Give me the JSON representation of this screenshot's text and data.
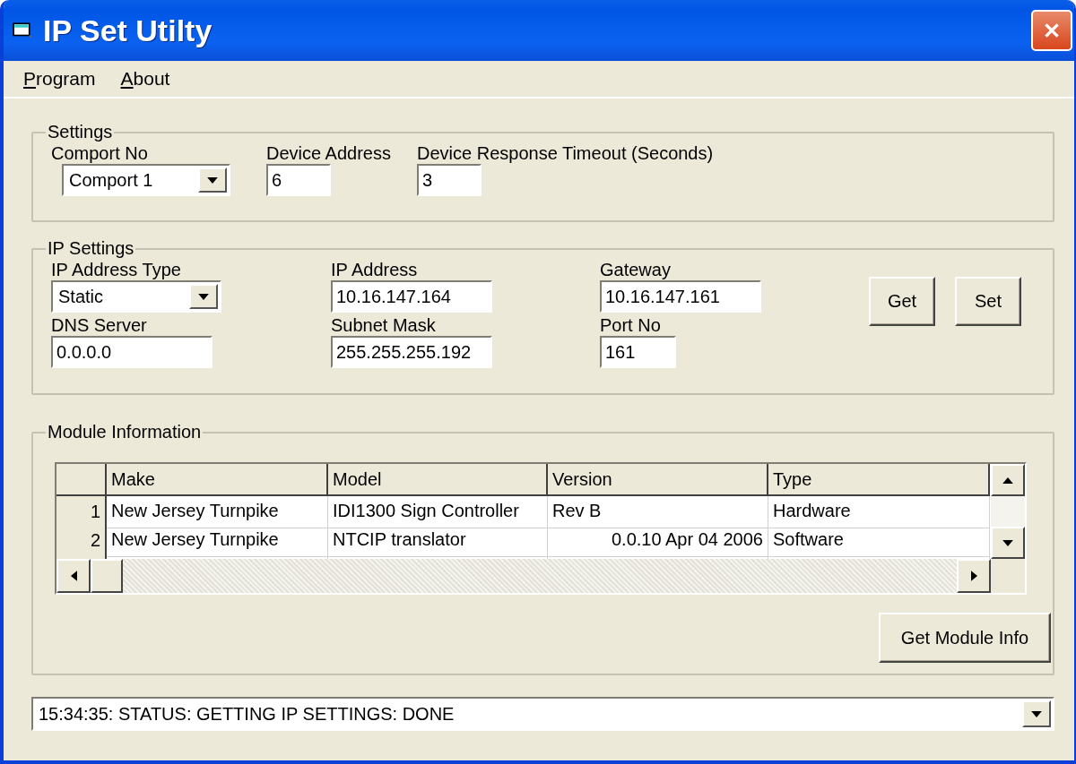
{
  "window": {
    "title": "IP Set Utilty"
  },
  "menu": [
    {
      "label": "Program"
    },
    {
      "label": "About"
    }
  ],
  "settings": {
    "legend": "Settings",
    "comport": {
      "label": "Comport No",
      "value": "Comport 1"
    },
    "device_address": {
      "label": "Device Address",
      "value": "6"
    },
    "timeout": {
      "label": "Device Response Timeout (Seconds)",
      "value": "3"
    }
  },
  "ip_settings": {
    "legend": "IP Settings",
    "ip_address_type": {
      "label": "IP Address Type",
      "value": "Static"
    },
    "ip_address": {
      "label": "IP Address",
      "value": "10.16.147.164"
    },
    "gateway": {
      "label": "Gateway",
      "value": "10.16.147.161"
    },
    "dns_server": {
      "label": "DNS Server",
      "value": "0.0.0.0"
    },
    "subnet_mask": {
      "label": "Subnet Mask",
      "value": "255.255.255.192"
    },
    "port_no": {
      "label": "Port No",
      "value": "161"
    },
    "buttons": [
      "Get",
      "Set"
    ]
  },
  "module_information": {
    "legend": "Module Information",
    "table": {
      "columns": [
        "Make",
        "Model",
        "Version",
        "Type"
      ],
      "rows": [
        {
          "number": "1",
          "cells": [
            {
              "text": "New Jersey Turnpike",
              "kind": "text"
            },
            {
              "text": "IDI1300 Sign Controller",
              "kind": "text"
            },
            {
              "text": "Rev B",
              "kind": "text"
            },
            {
              "text": "Hardware",
              "kind": "text"
            }
          ]
        },
        {
          "number": "2",
          "cells": [
            {
              "text": "New Jersey Turnpike",
              "kind": "text"
            },
            {
              "text": "NTCIP translator",
              "kind": "text"
            },
            {
              "text": "0.0.10  Apr 04 2006",
              "kind": "numeric"
            },
            {
              "text": "Software",
              "kind": "text"
            }
          ]
        }
      ]
    },
    "button": "Get Module Info"
  },
  "status_bar": {
    "value": "15:34:35: STATUS: GETTING IP SETTINGS: DONE"
  }
}
